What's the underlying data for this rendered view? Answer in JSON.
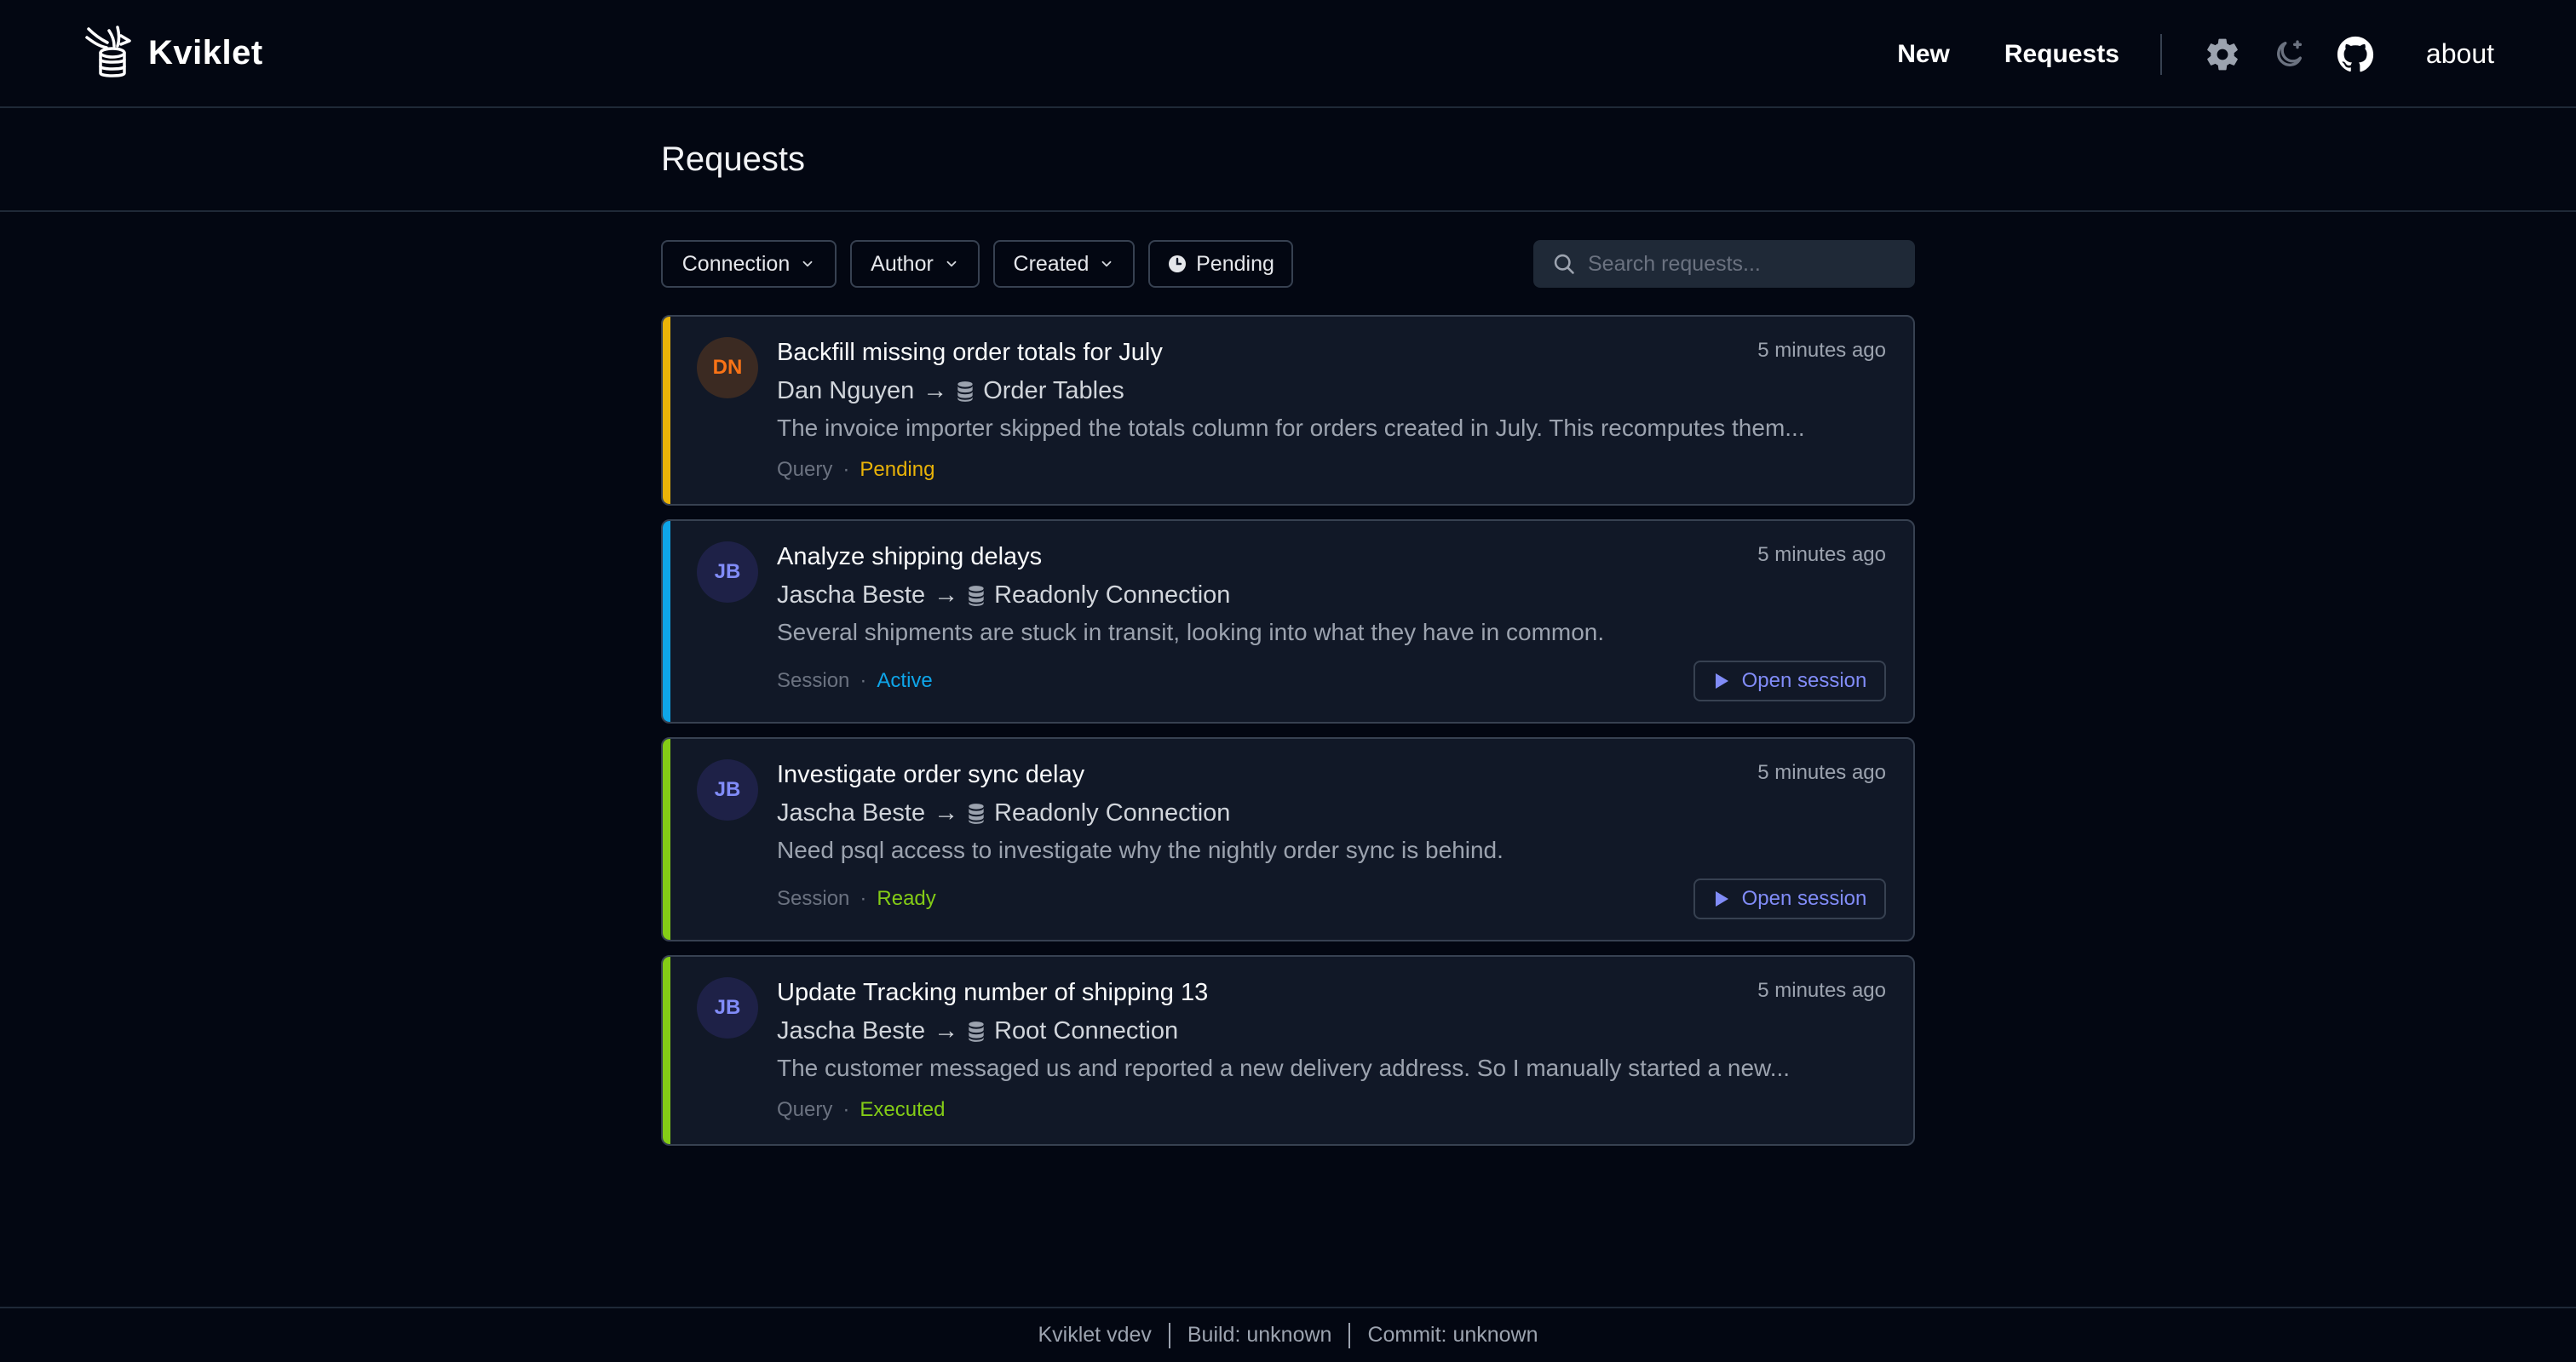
{
  "app": {
    "name": "Kviklet"
  },
  "nav": {
    "new_label": "New",
    "requests_label": "Requests",
    "about_label": "about",
    "icons": [
      "gear-icon",
      "moon-icon",
      "github-icon"
    ]
  },
  "page": {
    "title": "Requests"
  },
  "filters": {
    "connection_label": "Connection",
    "author_label": "Author",
    "created_label": "Created",
    "pending_label": "Pending",
    "search_placeholder": "Search requests..."
  },
  "requests": [
    {
      "initials": "DN",
      "title": "Backfill missing order totals for July",
      "time": "5 minutes ago",
      "author": "Dan Nguyen",
      "arrow": "→",
      "connection": "Order Tables",
      "description": "The invoice importer skipped the totals column for orders created in July. This recomputes them...",
      "type": "Query",
      "dot": "·",
      "status": "Pending",
      "status_color": "#eab308",
      "stripe_color": "#eab308",
      "avatar_bg": "#3b2a22",
      "avatar_fg": "#f97316"
    },
    {
      "initials": "JB",
      "title": "Analyze shipping delays",
      "time": "5 minutes ago",
      "author": "Jascha Beste",
      "arrow": "→",
      "connection": "Readonly Connection",
      "description": "Several shipments are stuck in transit, looking into what they have in common.",
      "type": "Session",
      "dot": "·",
      "status": "Active",
      "status_color": "#0ea5e9",
      "stripe_color": "#0ea5e9",
      "avatar_bg": "#1e2147",
      "avatar_fg": "#818cf8",
      "action_label": "Open session"
    },
    {
      "initials": "JB",
      "title": "Investigate order sync delay",
      "time": "5 minutes ago",
      "author": "Jascha Beste",
      "arrow": "→",
      "connection": "Readonly Connection",
      "description": "Need psql access to investigate why the nightly order sync is behind.",
      "type": "Session",
      "dot": "·",
      "status": "Ready",
      "status_color": "#84cc16",
      "stripe_color": "#84cc16",
      "avatar_bg": "#1e2147",
      "avatar_fg": "#818cf8",
      "action_label": "Open session"
    },
    {
      "initials": "JB",
      "title": "Update Tracking number of shipping 13",
      "time": "5 minutes ago",
      "author": "Jascha Beste",
      "arrow": "→",
      "connection": "Root Connection",
      "description": "The customer messaged us and reported a new delivery address. So I manually started a new...",
      "type": "Query",
      "dot": "·",
      "status": "Executed",
      "status_color": "#84cc16",
      "stripe_color": "#84cc16",
      "avatar_bg": "#1e2147",
      "avatar_fg": "#818cf8"
    }
  ],
  "footer": {
    "version": "Kviklet vdev",
    "build": "Build: unknown",
    "commit": "Commit: unknown"
  }
}
